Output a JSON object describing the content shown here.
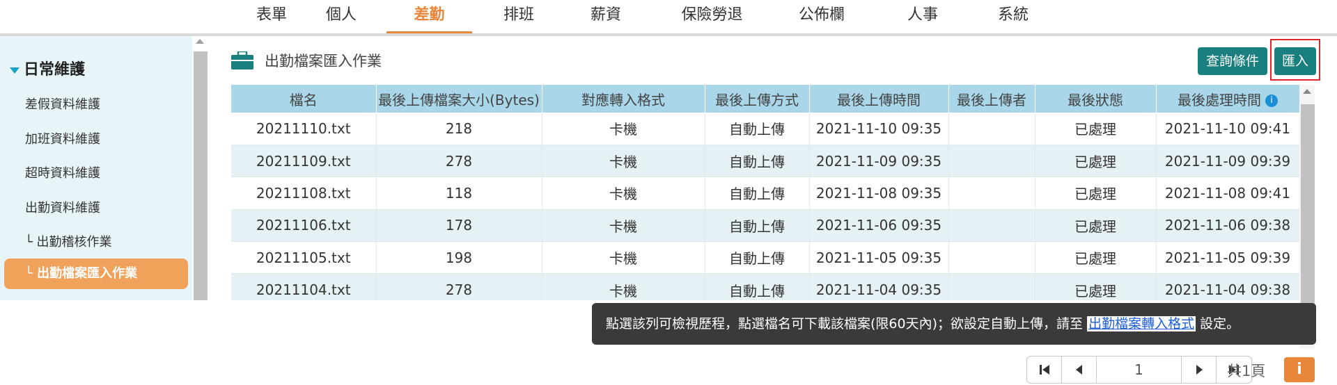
{
  "nav": {
    "tabs": [
      {
        "label": "表單"
      },
      {
        "label": "個人"
      },
      {
        "label": "差勤"
      },
      {
        "label": "排班"
      },
      {
        "label": "薪資"
      },
      {
        "label": "保險勞退"
      },
      {
        "label": "公佈欄"
      },
      {
        "label": "人事"
      },
      {
        "label": "系統"
      }
    ],
    "active_index": 2
  },
  "sidebar": {
    "section_title": "日常維護",
    "items": [
      {
        "label": "差假資料維護"
      },
      {
        "label": "加班資料維護"
      },
      {
        "label": "超時資料維護"
      },
      {
        "label": "出勤資料維護"
      },
      {
        "label": "└ 出勤稽核作業"
      },
      {
        "label": "└ 出勤檔案匯入作業"
      }
    ]
  },
  "page": {
    "title": "出勤檔案匯入作業",
    "icon": "briefcase-icon",
    "query_button": "查詢條件",
    "import_button": "匯入"
  },
  "table": {
    "columns": [
      "檔名",
      "最後上傳檔案大小(Bytes)",
      "對應轉入格式",
      "最後上傳方式",
      "最後上傳時間",
      "最後上傳者",
      "最後狀態",
      "最後處理時間"
    ],
    "rows": [
      [
        "20211110.txt",
        "218",
        "卡機",
        "自動上傳",
        "2021-11-10 09:35",
        "",
        "已處理",
        "2021-11-10 09:41"
      ],
      [
        "20211109.txt",
        "278",
        "卡機",
        "自動上傳",
        "2021-11-09 09:35",
        "",
        "已處理",
        "2021-11-09 09:39"
      ],
      [
        "20211108.txt",
        "118",
        "卡機",
        "自動上傳",
        "2021-11-08 09:35",
        "",
        "已處理",
        "2021-11-08 09:41"
      ],
      [
        "20211106.txt",
        "178",
        "卡機",
        "自動上傳",
        "2021-11-06 09:35",
        "",
        "已處理",
        "2021-11-06 09:38"
      ],
      [
        "20211105.txt",
        "198",
        "卡機",
        "自動上傳",
        "2021-11-05 09:35",
        "",
        "已處理",
        "2021-11-05 09:39"
      ],
      [
        "20211104.txt",
        "278",
        "卡機",
        "自動上傳",
        "2021-11-04 09:35",
        "",
        "已處理",
        "2021-11-04 09:38"
      ]
    ]
  },
  "tooltip": {
    "text_before": "點選該列可檢視歷程，點選檔名可下載該檔案(限60天內)；欲設定自動上傳，請至",
    "link": "出勤檔案轉入格式",
    "text_after": "設定。"
  },
  "pager": {
    "current_page": "1",
    "total": "共1頁",
    "info_label": "i"
  },
  "colors": {
    "accent": "#e8873a",
    "teal_button": "#1a7f7f",
    "header_bg": "#a9d6e8",
    "sidebar_bg": "#e8f5f8"
  }
}
